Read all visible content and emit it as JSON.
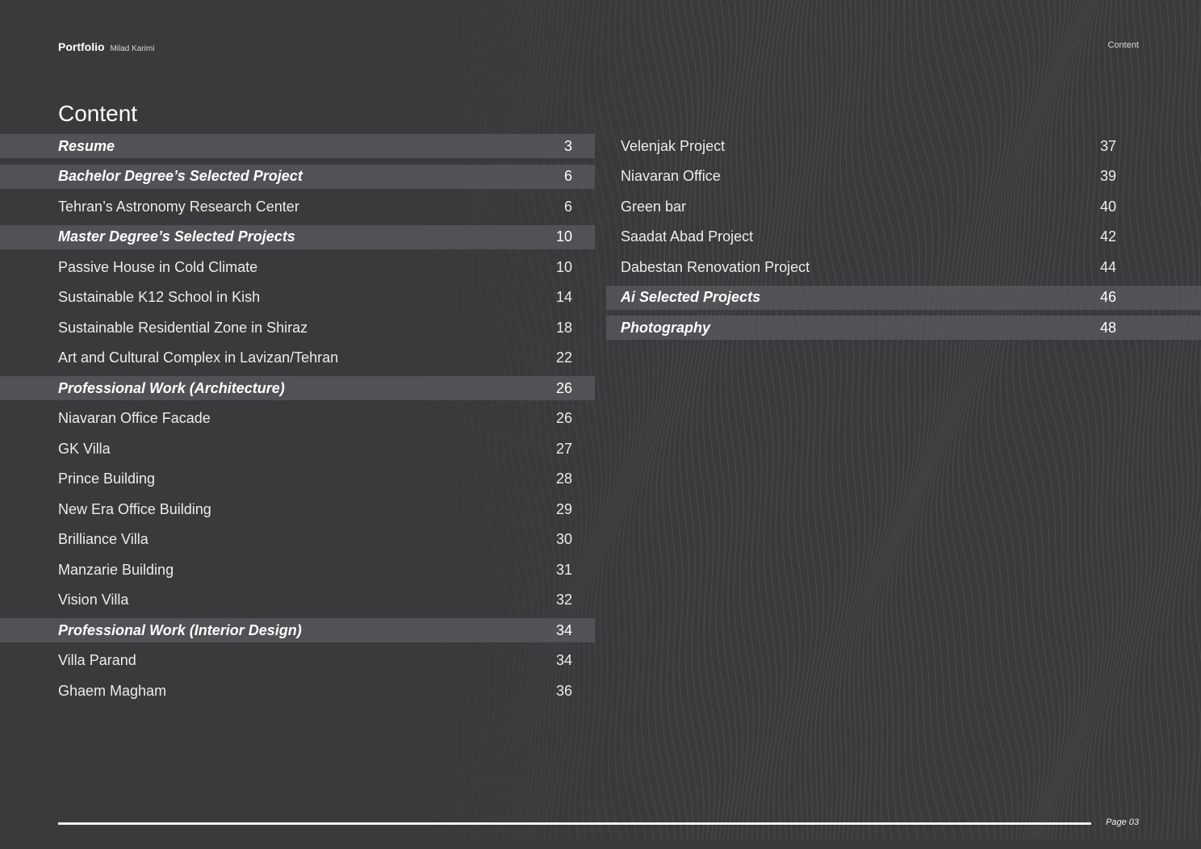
{
  "header": {
    "brand": "Portfolio",
    "author": "Milad Karimi",
    "section_label": "Content"
  },
  "title": "Content",
  "toc_left": [
    {
      "label": "Resume",
      "page": "3",
      "section": true
    },
    {
      "label": "Bachelor Degree’s Selected Project",
      "page": "6",
      "section": true
    },
    {
      "label": "Tehran’s Astronomy Research Center",
      "page": "6",
      "section": false
    },
    {
      "label": "Master Degree’s Selected Projects",
      "page": "10",
      "section": true
    },
    {
      "label": "Passive House in Cold Climate",
      "page": "10",
      "section": false
    },
    {
      "label": "Sustainable K12 School in Kish",
      "page": "14",
      "section": false
    },
    {
      "label": "Sustainable Residential Zone in Shiraz",
      "page": "18",
      "section": false
    },
    {
      "label": "Art and Cultural Complex in Lavizan/Tehran",
      "page": "22",
      "section": false
    },
    {
      "label": "Professional Work (Architecture)",
      "page": "26",
      "section": true
    },
    {
      "label": "Niavaran Office Facade",
      "page": "26",
      "section": false
    },
    {
      "label": "GK Villa",
      "page": "27",
      "section": false
    },
    {
      "label": "Prince Building",
      "page": "28",
      "section": false
    },
    {
      "label": "New Era Office Building",
      "page": "29",
      "section": false
    },
    {
      "label": "Brilliance Villa",
      "page": "30",
      "section": false
    },
    {
      "label": "Manzarie Building",
      "page": "31",
      "section": false
    },
    {
      "label": "Vision Villa",
      "page": "32",
      "section": false
    },
    {
      "label": "Professional Work (Interior Design)",
      "page": "34",
      "section": true
    },
    {
      "label": "Villa Parand",
      "page": "34",
      "section": false
    },
    {
      "label": "Ghaem Magham",
      "page": "36",
      "section": false
    }
  ],
  "toc_right": [
    {
      "label": "Velenjak Project",
      "page": "37",
      "section": false
    },
    {
      "label": "Niavaran Office",
      "page": "39",
      "section": false
    },
    {
      "label": "Green bar",
      "page": "40",
      "section": false
    },
    {
      "label": "Saadat Abad Project",
      "page": "42",
      "section": false
    },
    {
      "label": "Dabestan Renovation Project",
      "page": "44",
      "section": false
    },
    {
      "label": "Ai Selected Projects",
      "page": "46",
      "section": true
    },
    {
      "label": "Photography",
      "page": "48",
      "section": true
    }
  ],
  "footer": {
    "page_label": "Page 03"
  }
}
